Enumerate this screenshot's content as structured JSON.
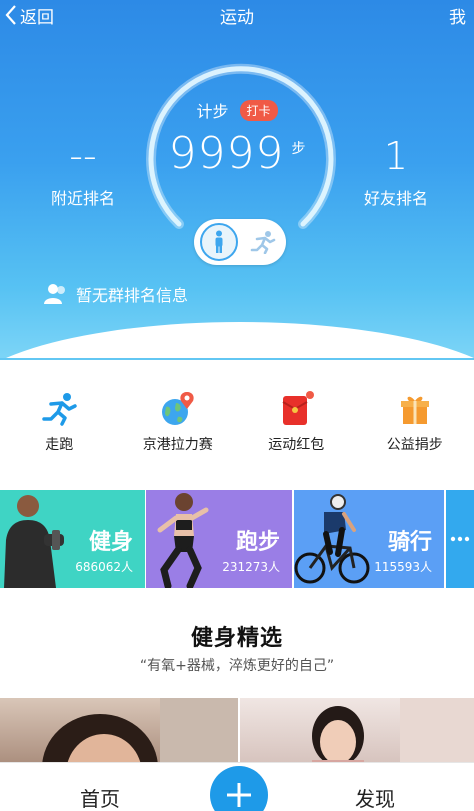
{
  "topbar": {
    "back_label": "返回",
    "title": "运动",
    "me_label": "我"
  },
  "steps": {
    "label": "计步",
    "checkin_label": "打卡",
    "value": "9999",
    "unit": "步"
  },
  "nearby_rank": {
    "value": "--",
    "label": "附近排名"
  },
  "friend_rank": {
    "value": "1",
    "label": "好友排名"
  },
  "group_rank": {
    "label": "暂无群排名信息"
  },
  "quick_actions": [
    {
      "label": "走跑",
      "icon": "runner-icon"
    },
    {
      "label": "京港拉力赛",
      "icon": "globe-pin-icon"
    },
    {
      "label": "运动红包",
      "icon": "red-envelope-icon",
      "badge": true
    },
    {
      "label": "公益捐步",
      "icon": "gift-icon"
    }
  ],
  "categories": [
    {
      "name": "健身",
      "count": "686062人",
      "color": "#3fd4c4"
    },
    {
      "name": "跑步",
      "count": "231273人",
      "color": "#9a7ee6"
    },
    {
      "name": "骑行",
      "count": "115593人",
      "color": "#5b9ff5"
    },
    {
      "name": "更多",
      "color": "#33a9ee"
    }
  ],
  "picks": {
    "title": "健身精选",
    "subtitle": "“有氧+器械，淬炼更好的自己”"
  },
  "bottom_nav": {
    "home_label": "首页",
    "discover_label": "发现"
  },
  "colors": {
    "primary": "#2d8ae6",
    "accent": "#1e9ae8",
    "badge": "#f05a46"
  }
}
